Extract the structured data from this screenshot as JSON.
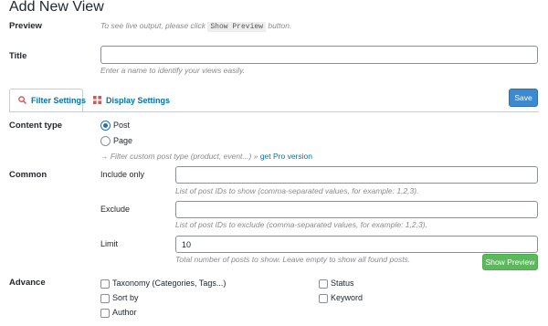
{
  "page": {
    "title": "Add New View"
  },
  "preview": {
    "label": "Preview",
    "hint_before": "To see live output, please click",
    "hint_code": "Show Preview",
    "hint_after": "button."
  },
  "title_field": {
    "label": "Title",
    "value": "",
    "hint": "Enter a name to identify your views easily."
  },
  "tabs": [
    {
      "label": "Filter Settings",
      "icon": "search-icon",
      "active": true
    },
    {
      "label": "Display Settings",
      "icon": "grid-icon",
      "active": false
    }
  ],
  "save_button": {
    "label": "Save"
  },
  "content_type": {
    "label": "Content type",
    "options": [
      {
        "label": "Post",
        "checked": true
      },
      {
        "label": "Page",
        "checked": false
      }
    ],
    "hint_prefix": "→ Filter custom post type (product, event...) »",
    "hint_link": "get Pro version"
  },
  "common": {
    "label": "Common",
    "include": {
      "label": "Include only",
      "value": "",
      "hint": "List of post IDs to show (comma-separated values, for example: 1,2,3)."
    },
    "exclude": {
      "label": "Exclude",
      "value": "",
      "hint": "List of post IDs to exclude (comma-separated values, for example: 1,2,3)."
    },
    "limit": {
      "label": "Limit",
      "value": "10",
      "hint": "Total number of posts to show. Leave empty to show all found posts."
    }
  },
  "show_preview_button": {
    "label": "Show Preview"
  },
  "advance": {
    "label": "Advance",
    "options": [
      {
        "label": "Taxonomy (Categories, Tags...)",
        "checked": false
      },
      {
        "label": "Sort by",
        "checked": false
      },
      {
        "label": "Author",
        "checked": false
      },
      {
        "label": "Status",
        "checked": false
      },
      {
        "label": "Keyword",
        "checked": false
      }
    ]
  },
  "colors": {
    "primary": "#3d8ad1",
    "success": "#5cb85c",
    "link": "#0073aa",
    "tab_icon_red": "#d9534f"
  }
}
